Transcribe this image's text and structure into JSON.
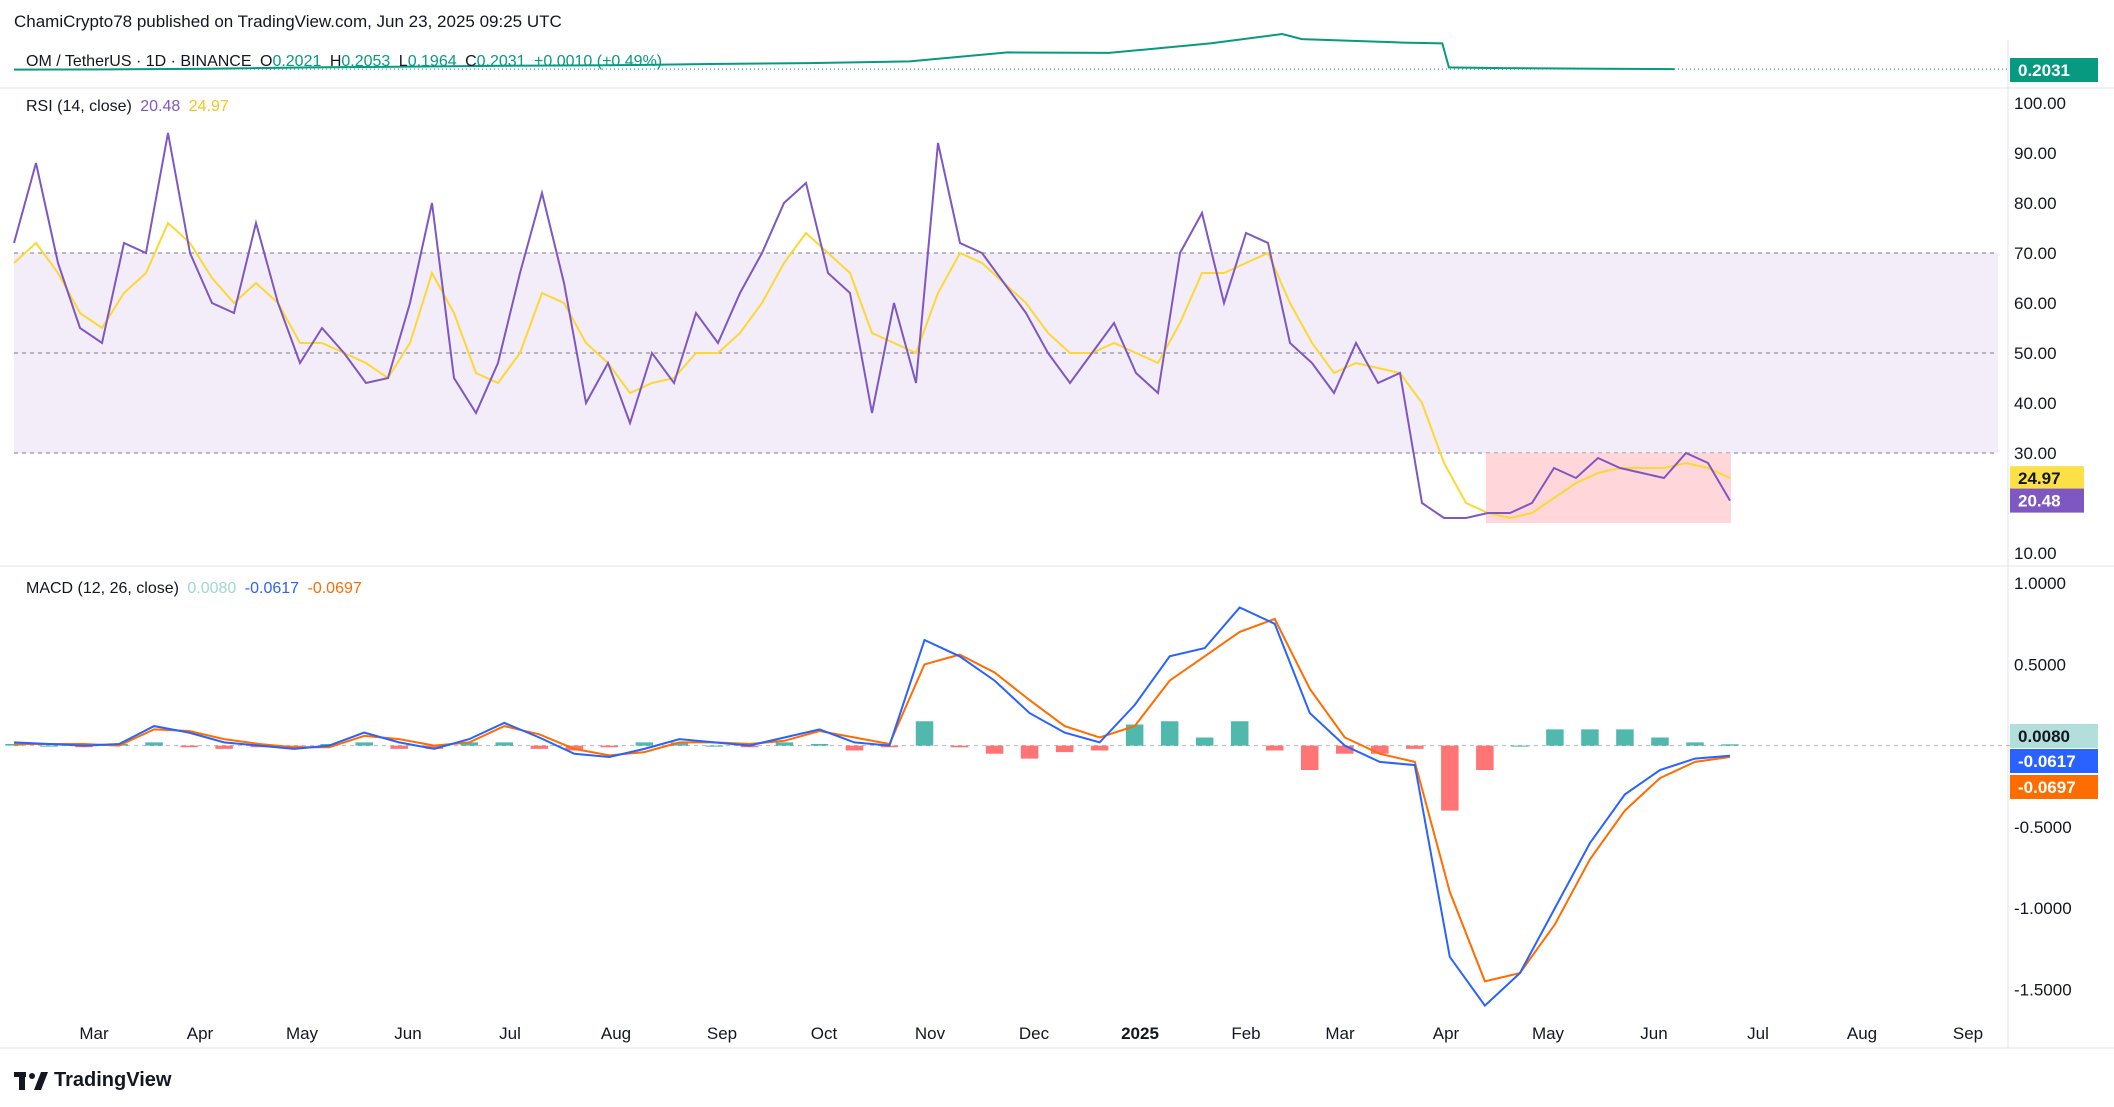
{
  "header": {
    "publisher": "ChamiCrypto78 published on TradingView.com, Jun 23, 2025 09:25 UTC"
  },
  "symbol_legend": {
    "symbol": "OM / TetherUS · 1D · BINANCE",
    "o_label": "O",
    "o_value": "0.2021",
    "h_label": "H",
    "h_value": "0.2053",
    "l_label": "L",
    "l_value": "0.1964",
    "c_label": "C",
    "c_value": "0.2031",
    "change": "+0.0010 (+0.49%)",
    "price_badge": "0.2031"
  },
  "rsi_legend": {
    "title": "RSI (14, close)",
    "rsi_value": "20.48",
    "ma_value": "24.97"
  },
  "macd_legend": {
    "title": "MACD (12, 26, close)",
    "hist_value": "0.0080",
    "macd_value": "-0.0617",
    "signal_value": "-0.0697"
  },
  "branding": {
    "logo_text": "TradingView"
  },
  "colors": {
    "up": "#089981",
    "down": "#f23645",
    "rsi": "#7e57c2",
    "rsi_ma": "#fdd835",
    "macd": "#2962ff",
    "signal": "#ff6d00",
    "hist_up": "#26a69a",
    "hist_down": "#ff5252",
    "band": "#ede7f6"
  },
  "chart_data": [
    {
      "type": "line",
      "title": "OM / TetherUS · 1D · BINANCE",
      "x": [
        "2024-02-01",
        "2024-03-01",
        "2024-04-01",
        "2024-05-01",
        "2024-06-01",
        "2024-07-01",
        "2024-08-01",
        "2024-09-01",
        "2024-10-01",
        "2024-11-01",
        "2024-12-01",
        "2025-01-01",
        "2025-02-01",
        "2025-02-23",
        "2025-03-01",
        "2025-04-01",
        "2025-04-13",
        "2025-04-15",
        "2025-05-01",
        "2025-06-01",
        "2025-06-23"
      ],
      "series": [
        {
          "values": [
            0.1,
            0.15,
            0.3,
            0.6,
            0.8,
            1.0,
            1.1,
            1.4,
            1.6,
            2.0,
            4.1,
            4.0,
            6.2,
            8.4,
            7.2,
            6.4,
            6.2,
            0.6,
            0.45,
            0.3,
            0.2031
          ]
        }
      ],
      "last_value": 0.2031
    },
    {
      "type": "line",
      "title": "RSI (14, close)",
      "ylim": [
        10,
        100
      ],
      "y_ticks": [
        "100.00",
        "90.00",
        "80.00",
        "70.00",
        "60.00",
        "50.00",
        "40.00",
        "30.00",
        "10.00"
      ],
      "bands": {
        "upper": 70,
        "middle": 50,
        "lower": 30
      },
      "x_labels": [
        "Mar",
        "Apr",
        "May",
        "Jun",
        "Jul",
        "Aug",
        "Sep",
        "Oct",
        "Nov",
        "Dec",
        "2025",
        "Feb",
        "Mar",
        "Apr",
        "May",
        "Jun",
        "Jul",
        "Aug",
        "Sep"
      ],
      "series": [
        {
          "name": "RSI",
          "values": [
            72,
            88,
            68,
            55,
            52,
            72,
            70,
            94,
            70,
            60,
            58,
            76,
            60,
            48,
            55,
            50,
            44,
            45,
            60,
            80,
            45,
            38,
            48,
            66,
            82,
            64,
            40,
            48,
            36,
            50,
            44,
            58,
            52,
            62,
            70,
            80,
            84,
            66,
            62,
            38,
            60,
            44,
            92,
            72,
            70,
            64,
            58,
            50,
            44,
            50,
            56,
            46,
            42,
            70,
            78,
            60,
            74,
            72,
            52,
            48,
            42,
            52,
            44,
            46,
            20,
            17,
            17,
            18,
            18,
            20,
            27,
            25,
            29,
            27,
            26,
            25,
            30,
            28,
            20.48
          ]
        },
        {
          "name": "MA",
          "values": [
            68,
            72,
            66,
            58,
            55,
            62,
            66,
            76,
            72,
            65,
            60,
            64,
            60,
            52,
            52,
            50,
            48,
            45,
            52,
            66,
            58,
            46,
            44,
            50,
            62,
            60,
            52,
            48,
            42,
            44,
            45,
            50,
            50,
            54,
            60,
            68,
            74,
            70,
            66,
            54,
            52,
            50,
            62,
            70,
            68,
            64,
            60,
            54,
            50,
            50,
            52,
            50,
            48,
            56,
            66,
            66,
            68,
            70,
            60,
            52,
            46,
            48,
            47,
            46,
            40,
            28,
            20,
            18,
            17,
            18,
            21,
            24,
            26,
            27,
            27,
            27,
            28,
            27,
            24.97
          ]
        }
      ],
      "last_values": {
        "ma": 24.97,
        "rsi": 20.48
      }
    },
    {
      "type": "line",
      "title": "MACD (12, 26, close)",
      "ylim": [
        -1.75,
        1.05
      ],
      "y_ticks": [
        "1.0000",
        "0.5000",
        "-0.5000",
        "-1.0000",
        "-1.5000"
      ],
      "series": [
        {
          "name": "MACD",
          "values": [
            0.02,
            0.01,
            0.0,
            0.01,
            0.12,
            0.08,
            0.02,
            0.0,
            -0.02,
            0.0,
            0.08,
            0.02,
            -0.02,
            0.04,
            0.14,
            0.05,
            -0.05,
            -0.07,
            -0.02,
            0.04,
            0.02,
            0.0,
            0.05,
            0.1,
            0.02,
            0.0,
            0.65,
            0.55,
            0.4,
            0.2,
            0.08,
            0.02,
            0.25,
            0.55,
            0.6,
            0.85,
            0.75,
            0.2,
            0.0,
            -0.1,
            -0.12,
            -1.3,
            -1.6,
            -1.4,
            -1.0,
            -0.6,
            -0.3,
            -0.15,
            -0.08,
            -0.0617
          ]
        },
        {
          "name": "Signal",
          "values": [
            0.01,
            0.01,
            0.01,
            0.0,
            0.1,
            0.09,
            0.04,
            0.01,
            -0.01,
            -0.01,
            0.06,
            0.04,
            0.0,
            0.02,
            0.12,
            0.07,
            -0.02,
            -0.06,
            -0.04,
            0.02,
            0.02,
            0.01,
            0.03,
            0.09,
            0.05,
            0.01,
            0.5,
            0.56,
            0.45,
            0.28,
            0.12,
            0.05,
            0.12,
            0.4,
            0.55,
            0.7,
            0.78,
            0.35,
            0.05,
            -0.05,
            -0.1,
            -0.9,
            -1.45,
            -1.4,
            -1.1,
            -0.7,
            -0.4,
            -0.2,
            -0.1,
            -0.0697
          ]
        },
        {
          "name": "Histogram",
          "values": [
            0.01,
            0.0,
            -0.01,
            0.01,
            0.02,
            -0.01,
            -0.02,
            -0.01,
            -0.01,
            0.01,
            0.02,
            -0.02,
            -0.02,
            0.02,
            0.02,
            -0.02,
            -0.03,
            -0.01,
            0.02,
            0.02,
            0.0,
            -0.01,
            0.02,
            0.01,
            -0.03,
            -0.01,
            0.15,
            -0.01,
            -0.05,
            -0.08,
            -0.04,
            -0.03,
            0.13,
            0.15,
            0.05,
            0.15,
            -0.03,
            -0.15,
            -0.05,
            -0.05,
            -0.02,
            -0.4,
            -0.15,
            0.0,
            0.1,
            0.1,
            0.1,
            0.05,
            0.02,
            0.008
          ]
        }
      ],
      "last_values": {
        "histogram": 0.008,
        "macd": -0.0617,
        "signal": -0.0697
      }
    }
  ]
}
